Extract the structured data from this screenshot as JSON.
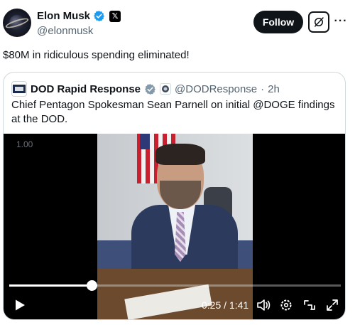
{
  "author": {
    "display_name": "Elon Musk",
    "handle": "@elonmusk",
    "verified_badge": "verified-badge-icon",
    "affiliate_badge_text": "𝕏"
  },
  "actions": {
    "follow_label": "Follow",
    "grok_icon": "grok-icon",
    "more_icon": "more-icon",
    "more_glyph": "···"
  },
  "tweet": {
    "text": "$80M in ridiculous spending eliminated!"
  },
  "quote": {
    "display_name": "DOD Rapid Response",
    "handle": "@DODResponse",
    "separator": "·",
    "time": "2h",
    "text": "Chief Pentagon Spokesman Sean Parnell on initial @DOGE findings at the DOD."
  },
  "video": {
    "speed_label": "1.00",
    "time_readout": "0:25 / 1:41",
    "progress": 0.2475,
    "icons": [
      "play-icon",
      "volume-icon",
      "settings-icon",
      "minimize-icon",
      "fullscreen-icon"
    ]
  },
  "colors": {
    "text": "#0f1419",
    "secondary": "#536471",
    "verified_blue": "#1d9bf0",
    "border": "#cfd9de"
  }
}
